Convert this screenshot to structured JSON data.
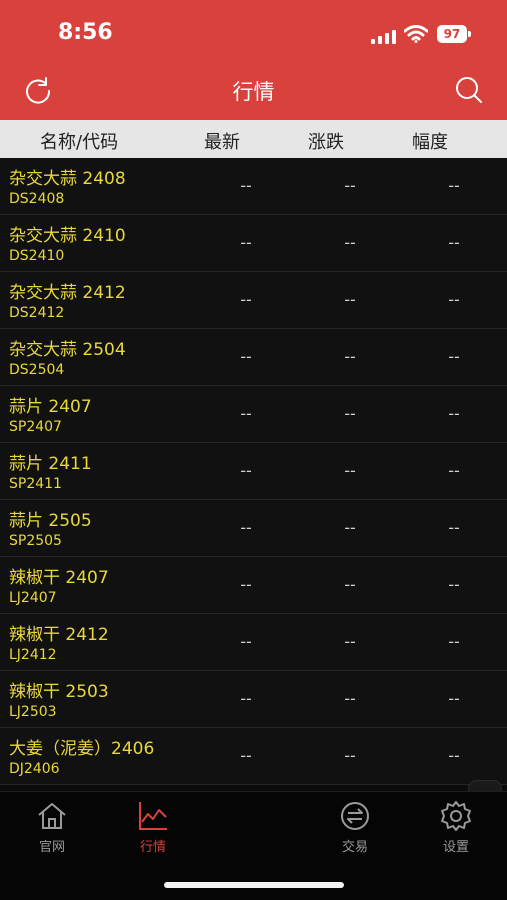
{
  "status_bar": {
    "time": "8:56",
    "battery": "97"
  },
  "nav": {
    "title": "行情",
    "left_icon": "refresh-icon",
    "right_icon": "search-icon"
  },
  "columns": {
    "name": "名称/代码",
    "latest": "最新",
    "change": "涨跌",
    "range": "幅度"
  },
  "rows": [
    {
      "name": "杂交大蒜 2408",
      "code": "DS2408",
      "latest": "--",
      "change": "--",
      "range": "--"
    },
    {
      "name": "杂交大蒜 2410",
      "code": "DS2410",
      "latest": "--",
      "change": "--",
      "range": "--"
    },
    {
      "name": "杂交大蒜 2412",
      "code": "DS2412",
      "latest": "--",
      "change": "--",
      "range": "--"
    },
    {
      "name": "杂交大蒜 2504",
      "code": "DS2504",
      "latest": "--",
      "change": "--",
      "range": "--"
    },
    {
      "name": "蒜片 2407",
      "code": "SP2407",
      "latest": "--",
      "change": "--",
      "range": "--"
    },
    {
      "name": "蒜片 2411",
      "code": "SP2411",
      "latest": "--",
      "change": "--",
      "range": "--"
    },
    {
      "name": "蒜片 2505",
      "code": "SP2505",
      "latest": "--",
      "change": "--",
      "range": "--"
    },
    {
      "name": "辣椒干 2407",
      "code": "LJ2407",
      "latest": "--",
      "change": "--",
      "range": "--"
    },
    {
      "name": "辣椒干 2412",
      "code": "LJ2412",
      "latest": "--",
      "change": "--",
      "range": "--"
    },
    {
      "name": "辣椒干 2503",
      "code": "LJ2503",
      "latest": "--",
      "change": "--",
      "range": "--"
    },
    {
      "name": "大姜（泥姜）2406",
      "code": "DJ2406",
      "latest": "--",
      "change": "--",
      "range": "--"
    }
  ],
  "tabs": [
    {
      "label": "官网",
      "icon": "home-icon",
      "active": false
    },
    {
      "label": "行情",
      "icon": "chart-icon",
      "active": true
    },
    {
      "label": "交易",
      "icon": "exchange-icon",
      "active": false
    },
    {
      "label": "设置",
      "icon": "gear-icon",
      "active": false
    }
  ],
  "colors": {
    "header": "#d8413c",
    "accent_text": "#e8d83a",
    "background": "#111111",
    "active_tab": "#d8413c"
  }
}
